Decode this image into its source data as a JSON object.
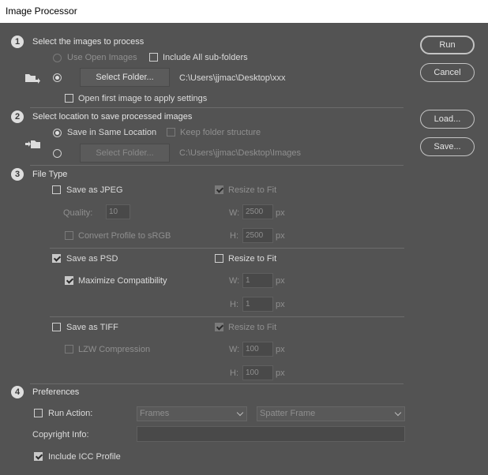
{
  "window": {
    "title": "Image Processor"
  },
  "buttons": {
    "run": "Run",
    "cancel": "Cancel",
    "load": "Load...",
    "save": "Save..."
  },
  "section1": {
    "number": "1",
    "title": "Select the images to process",
    "use_open_images": "Use Open Images",
    "include_subfolders": "Include All sub-folders",
    "select_folder": "Select Folder...",
    "folder_path": "C:\\Users\\jjmac\\Desktop\\xxx",
    "open_first_image": "Open first image to apply settings"
  },
  "section2": {
    "number": "2",
    "title": "Select location to save processed images",
    "save_same_location": "Save in Same Location",
    "keep_structure": "Keep folder structure",
    "select_folder": "Select Folder...",
    "folder_path": "C:\\Users\\jjmac\\Desktop\\Images"
  },
  "section3": {
    "number": "3",
    "title": "File Type",
    "jpeg": {
      "label": "Save as JPEG",
      "resize": "Resize to Fit",
      "quality_label": "Quality:",
      "quality": "10",
      "convert_profile": "Convert Profile to sRGB",
      "w_label": "W:",
      "w": "2500",
      "h_label": "H:",
      "h": "2500",
      "unit": "px"
    },
    "psd": {
      "label": "Save as PSD",
      "resize": "Resize to Fit",
      "maximize": "Maximize Compatibility",
      "w_label": "W:",
      "w": "1",
      "h_label": "H:",
      "h": "1",
      "unit": "px"
    },
    "tiff": {
      "label": "Save as TIFF",
      "resize": "Resize to Fit",
      "lzw": "LZW Compression",
      "w_label": "W:",
      "w": "100",
      "h_label": "H:",
      "h": "100",
      "unit": "px"
    }
  },
  "section4": {
    "number": "4",
    "title": "Preferences",
    "run_action": "Run Action:",
    "action_set": "Frames",
    "action": "Spatter Frame",
    "copyright_label": "Copyright Info:",
    "copyright_value": "",
    "include_icc": "Include ICC Profile"
  }
}
